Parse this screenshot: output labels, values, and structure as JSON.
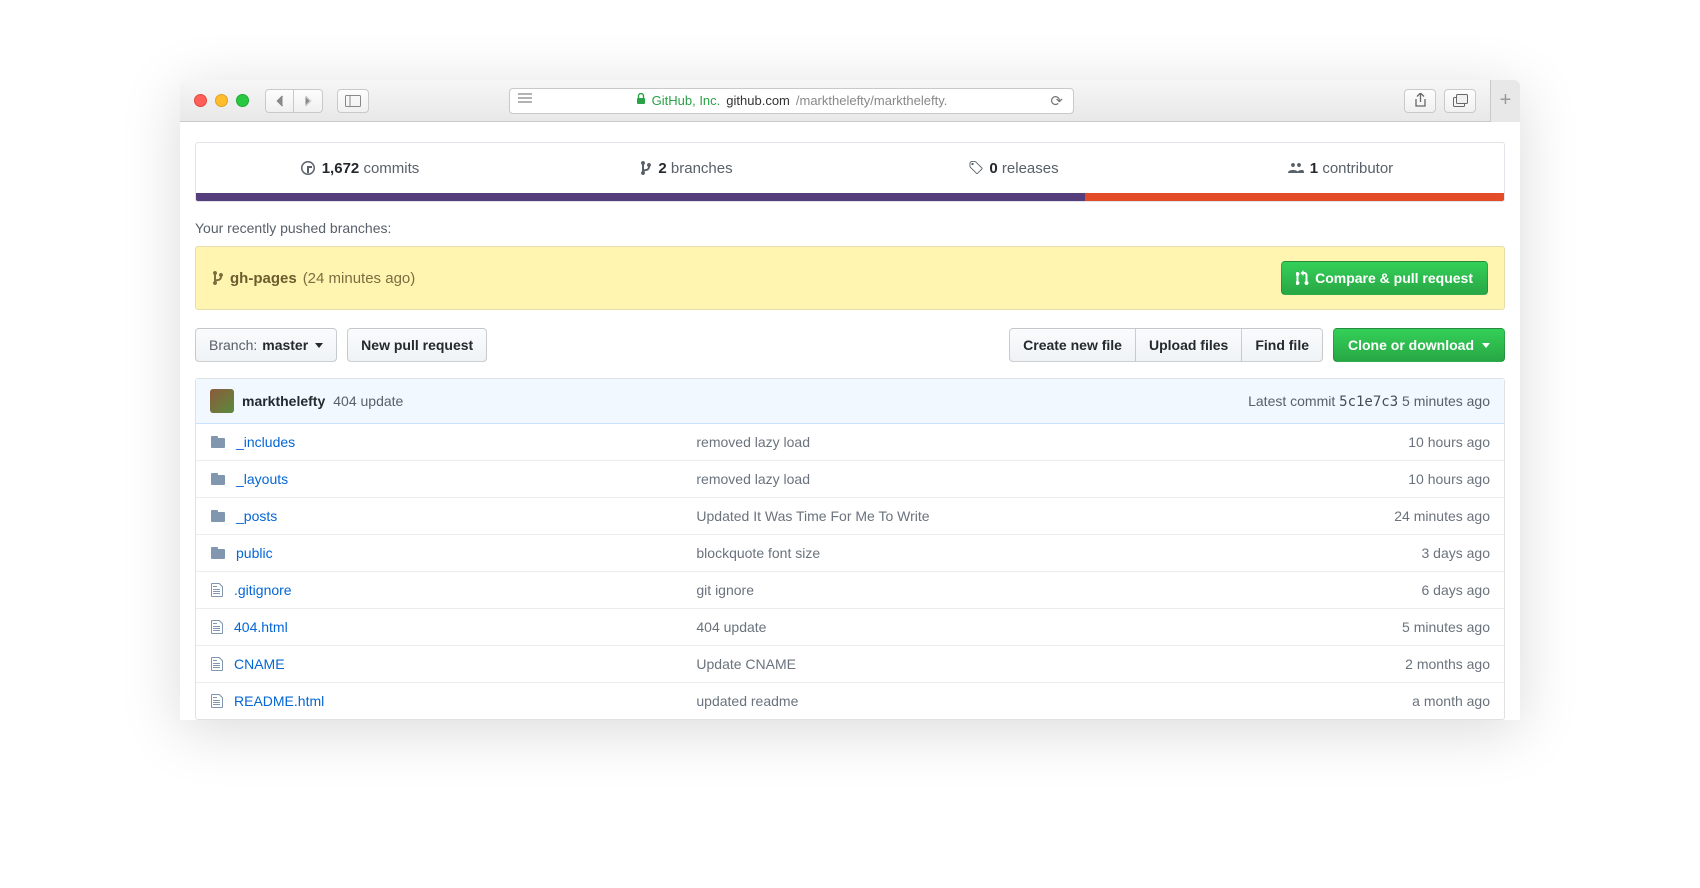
{
  "browser": {
    "cert": "GitHub, Inc.",
    "domain": "github.com",
    "path": "/markthelefty/markthelefty."
  },
  "summary": {
    "commits_count": "1,672",
    "commits_label": "commits",
    "branches_count": "2",
    "branches_label": "branches",
    "releases_count": "0",
    "releases_label": "releases",
    "contributors_count": "1",
    "contributors_label": "contributor"
  },
  "pushed_heading": "Your recently pushed branches:",
  "push_banner": {
    "branch": "gh-pages",
    "time": "(24 minutes ago)",
    "button": "Compare & pull request"
  },
  "toolbar": {
    "branch_label": "Branch:",
    "branch_name": "master",
    "new_pr": "New pull request",
    "create_file": "Create new file",
    "upload": "Upload files",
    "find": "Find file",
    "clone": "Clone or download"
  },
  "latest_commit": {
    "author": "markthelefty",
    "message": "404 update",
    "label": "Latest commit",
    "sha": "5c1e7c3",
    "time": "5 minutes ago"
  },
  "files": [
    {
      "type": "folder",
      "name": "_includes",
      "msg": "removed lazy load",
      "age": "10 hours ago"
    },
    {
      "type": "folder",
      "name": "_layouts",
      "msg": "removed lazy load",
      "age": "10 hours ago"
    },
    {
      "type": "folder",
      "name": "_posts",
      "msg": "Updated It Was Time For Me To Write",
      "age": "24 minutes ago"
    },
    {
      "type": "folder",
      "name": "public",
      "msg": "blockquote font size",
      "age": "3 days ago"
    },
    {
      "type": "file",
      "name": ".gitignore",
      "msg": "git ignore",
      "age": "6 days ago"
    },
    {
      "type": "file",
      "name": "404.html",
      "msg": "404 update",
      "age": "5 minutes ago"
    },
    {
      "type": "file",
      "name": "CNAME",
      "msg": "Update CNAME",
      "age": "2 months ago"
    },
    {
      "type": "file",
      "name": "README.html",
      "msg": "updated readme",
      "age": "a month ago"
    }
  ]
}
